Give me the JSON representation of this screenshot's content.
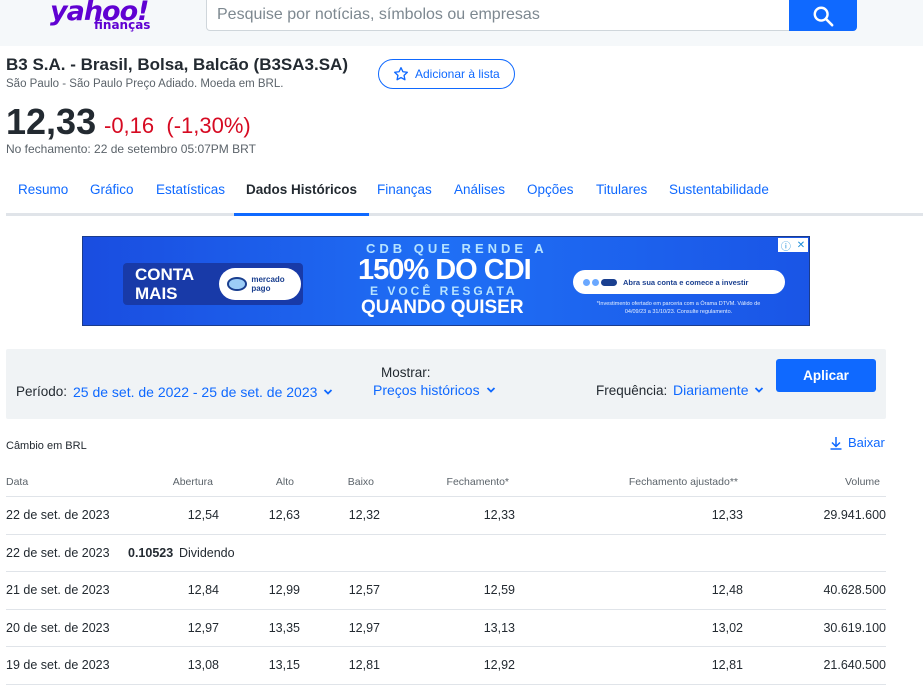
{
  "header": {
    "logo_brand": "yahoo!",
    "logo_sub": "finanças",
    "search_placeholder": "Pesquise por notícias, símbolos ou empresas",
    "search_icon": "search-icon"
  },
  "quote": {
    "title": "B3 S.A. - Brasil, Bolsa, Balcão (B3SA3.SA)",
    "subtitle": "São Paulo - São Paulo Preço Adiado. Moeda em BRL.",
    "watchlist_label": "Adicionar à lista",
    "price": "12,33",
    "change": "-0,16",
    "change_pct": "(-1,30%)",
    "closed_note": "No fechamento: 22 de setembro 05:07PM BRT",
    "negative_color": "#d60a22"
  },
  "tabs": [
    {
      "label": "Resumo"
    },
    {
      "label": "Gráfico"
    },
    {
      "label": "Estatísticas"
    },
    {
      "label": "Dados Históricos",
      "active": true
    },
    {
      "label": "Finanças"
    },
    {
      "label": "Análises"
    },
    {
      "label": "Opções"
    },
    {
      "label": "Titulares"
    },
    {
      "label": "Sustentabilidade"
    }
  ],
  "ad": {
    "badge": "CONTA MAIS",
    "brand": "mercado pago",
    "line1": "CDB QUE RENDE A",
    "line2": "150% DO CDI",
    "line3": "E VOCÊ RESGATA",
    "line4": "QUANDO QUISER",
    "cta": "Abra sua conta e comece a investir",
    "fine_print": "*Investimento ofertado em parceria com a Órama DTVM. Válido de 04/09/23 a 31/10/23. Consulte regulamento."
  },
  "filters": {
    "period_label": "Período:",
    "period_value": "25 de set. de 2022 - 25 de set. de 2023",
    "show_label": "Mostrar:",
    "show_value": "Preços históricos",
    "frequency_label": "Frequência:",
    "frequency_value": "Diariamente",
    "apply_label": "Aplicar"
  },
  "currency_note": "Câmbio em BRL",
  "download_label": "Baixar",
  "table": {
    "headers": [
      "Data",
      "Abertura",
      "Alto",
      "Baixo",
      "Fechamento*",
      "Fechamento ajustado**",
      "Volume"
    ],
    "rows": [
      {
        "type": "price",
        "cells": [
          "22 de set. de 2023",
          "12,54",
          "12,63",
          "12,32",
          "12,33",
          "12,33",
          "29.941.600"
        ]
      },
      {
        "type": "dividend",
        "cells": [
          "22 de set. de 2023",
          "0.10523",
          "Dividendo"
        ]
      },
      {
        "type": "price",
        "cells": [
          "21 de set. de 2023",
          "12,84",
          "12,99",
          "12,57",
          "12,59",
          "12,48",
          "40.628.500"
        ]
      },
      {
        "type": "price",
        "cells": [
          "20 de set. de 2023",
          "12,97",
          "13,35",
          "12,97",
          "13,13",
          "13,02",
          "30.619.100"
        ]
      },
      {
        "type": "price",
        "cells": [
          "19 de set. de 2023",
          "13,08",
          "13,15",
          "12,81",
          "12,92",
          "12,81",
          "21.640.500"
        ]
      }
    ]
  }
}
